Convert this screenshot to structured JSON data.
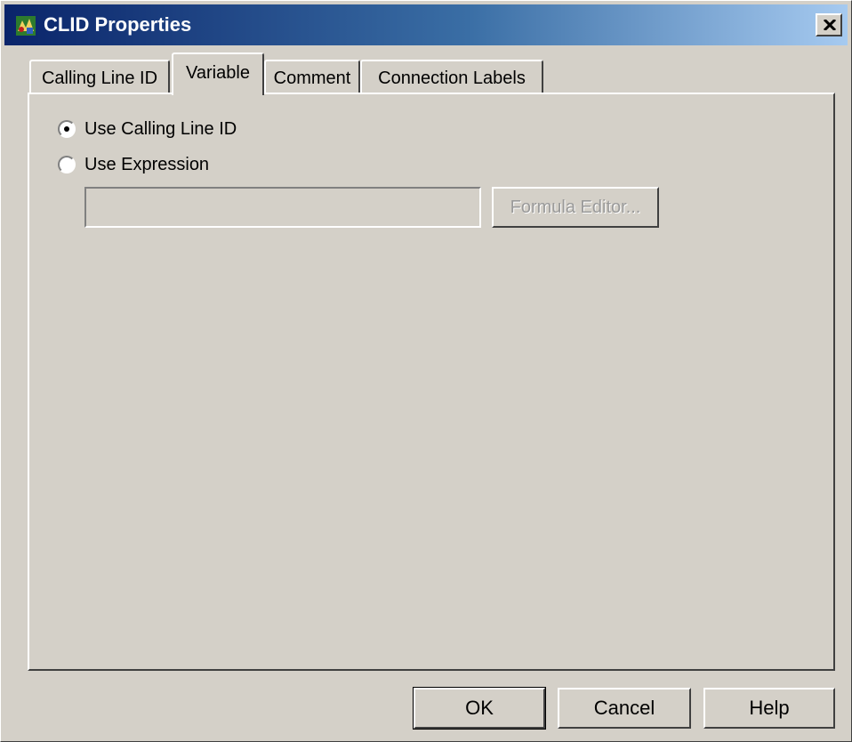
{
  "window": {
    "title": "CLID Properties",
    "icon": "clid-app-icon",
    "close_icon": "close-icon"
  },
  "tabs": [
    {
      "label": "Calling Line ID",
      "active": false
    },
    {
      "label": "Variable",
      "active": true
    },
    {
      "label": "Comment",
      "active": false
    },
    {
      "label": "Connection Labels",
      "active": false
    }
  ],
  "variable_tab": {
    "options": [
      {
        "label": "Use Calling Line ID",
        "selected": true
      },
      {
        "label": "Use Expression",
        "selected": false
      }
    ],
    "expression_value": "",
    "formula_button": {
      "label": "Formula Editor...",
      "enabled": false
    }
  },
  "buttons": {
    "ok": "OK",
    "cancel": "Cancel",
    "help": "Help"
  }
}
